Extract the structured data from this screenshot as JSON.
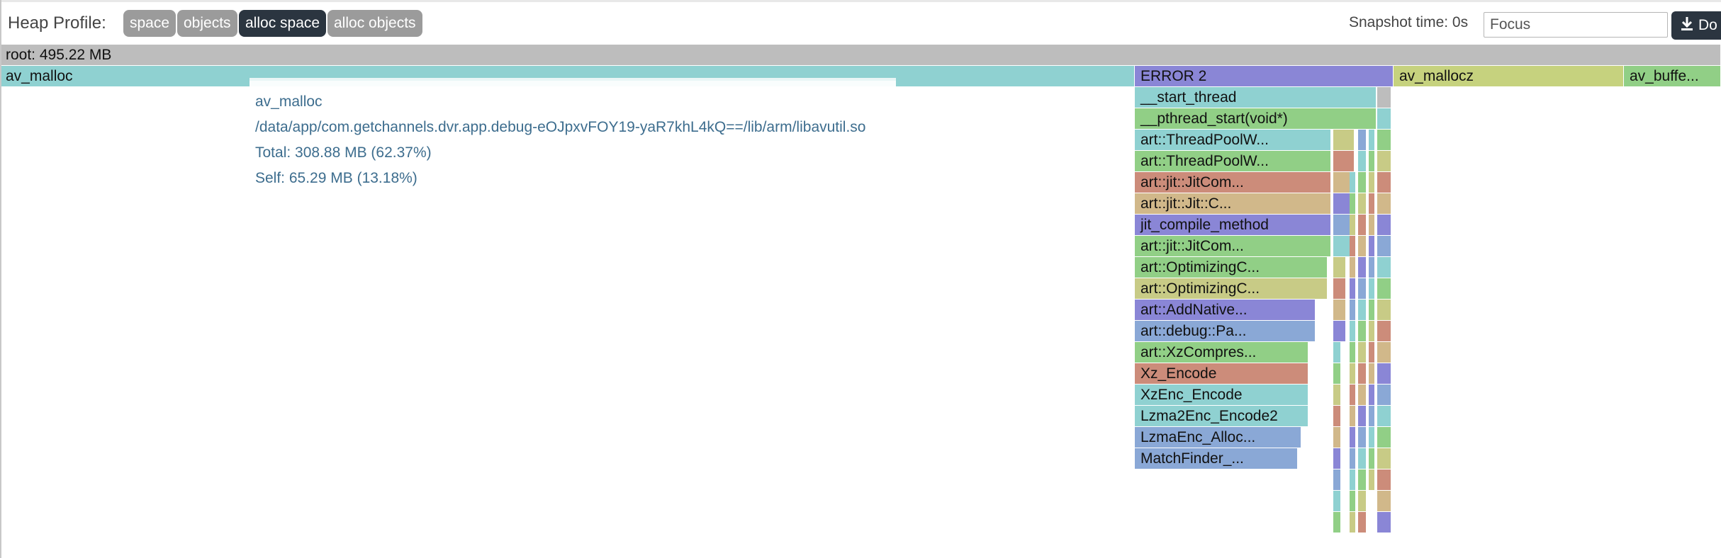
{
  "toolbar": {
    "title": "Heap Profile:",
    "modes": [
      "space",
      "objects",
      "alloc space",
      "alloc objects"
    ],
    "active_mode": "alloc space",
    "snapshot_text": "Snapshot time: 0s",
    "focus_placeholder": "Focus",
    "download_label": "Do",
    "download_icon": "download-icon"
  },
  "flamegraph": {
    "root_label": "root: 495.22 MB",
    "colors": {
      "root": "#bdbdbd",
      "teal": "#8fd1d1",
      "purple": "#8a86d6",
      "lime": "#c6d27e",
      "green": "#91cf86",
      "olive": "#c8cb86",
      "salmon": "#cc8c7a",
      "tan": "#d1b88a",
      "blue": "#8aa8d6"
    },
    "row1": [
      {
        "label": "av_malloc",
        "color": "teal"
      },
      {
        "label": "ERROR 2",
        "color": "purple"
      },
      {
        "label": "av_mallocz",
        "color": "lime"
      },
      {
        "label": "av_buffe...",
        "color": "green"
      }
    ],
    "stack": [
      {
        "label": "__start_thread",
        "color": "teal"
      },
      {
        "label": "__pthread_start(void*)",
        "color": "green"
      },
      {
        "label": "art::ThreadPoolW...",
        "color": "teal"
      },
      {
        "label": "art::ThreadPoolW...",
        "color": "green"
      },
      {
        "label": "art::jit::JitCom...",
        "color": "salmon"
      },
      {
        "label": "art::jit::Jit::C...",
        "color": "tan"
      },
      {
        "label": "jit_compile_method",
        "color": "purple"
      },
      {
        "label": "art::jit::JitCom...",
        "color": "green"
      },
      {
        "label": "art::OptimizingC...",
        "color": "green"
      },
      {
        "label": "art::OptimizingC...",
        "color": "olive"
      },
      {
        "label": "art::AddNative...",
        "color": "purple"
      },
      {
        "label": "art::debug::Pa...",
        "color": "blue"
      },
      {
        "label": "art::XzCompres...",
        "color": "green"
      },
      {
        "label": "Xz_Encode",
        "color": "salmon"
      },
      {
        "label": "XzEnc_Encode",
        "color": "teal"
      },
      {
        "label": "Lzma2Enc_Encode2",
        "color": "teal"
      },
      {
        "label": "LzmaEnc_Alloc...",
        "color": "blue"
      },
      {
        "label": "MatchFinder_...",
        "color": "blue"
      }
    ]
  },
  "tooltip": {
    "name": "av_malloc",
    "path": "/data/app/com.getchannels.dvr.app.debug-eOJpxvFOY19-yaR7khL4kQ==/lib/arm/libavutil.so",
    "total": "Total: 308.88 MB (62.37%)",
    "self": "Self: 65.29 MB (13.18%)"
  }
}
